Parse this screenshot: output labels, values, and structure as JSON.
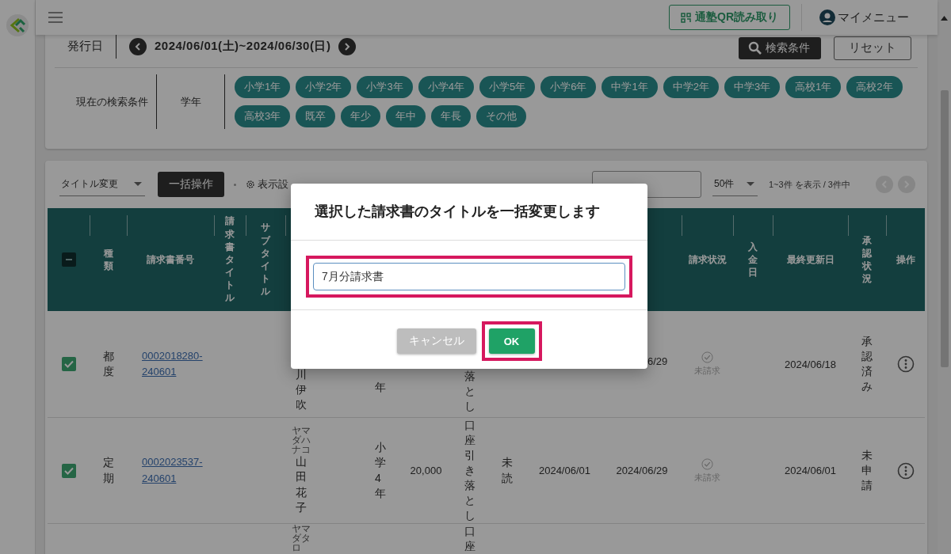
{
  "top_bar": {
    "qr_button": "通塾QR読み取り",
    "my_menu": "マイメニュー"
  },
  "search_panel": {
    "date_label": "発行日",
    "date_range": "2024/06/01(土)~2024/06/30(日)",
    "search_button": "検索条件",
    "reset_button": "リセット",
    "conditions_label": "現在の検索条件",
    "condition_name": "学年",
    "chips": [
      "小学1年",
      "小学2年",
      "小学3年",
      "小学4年",
      "小学5年",
      "小学6年",
      "中学1年",
      "中学2年",
      "中学3年",
      "高校1年",
      "高校2年",
      "高校3年",
      "既卒",
      "年少",
      "年中",
      "年長",
      "その他"
    ]
  },
  "list_toolbar": {
    "action_select": "タイトル変更",
    "bulk_button": "一括操作",
    "display_settings": "表示設",
    "page_size": "50件",
    "range_text": "1~3件 を表示 / 3件中",
    "prev_page": {
      "disabled": true
    },
    "next_page": {
      "disabled": true
    }
  },
  "table": {
    "select_all": {
      "indeterminate": true
    },
    "columns": [
      "種類",
      "請求書番号",
      "請求書タイトル",
      "サブタイトル",
      "請求状況",
      "入金日",
      "最終更新日",
      "承認状況",
      "操作"
    ],
    "rows": [
      {
        "selected": true,
        "type": "都度",
        "invoice_no": "0002018280-240601",
        "name": "川伊吹",
        "grade": "年",
        "payment": "落とし",
        "due": "6/29",
        "status": "未請求",
        "updated": "2024/06/18",
        "approval": "承認済み"
      },
      {
        "selected": true,
        "type": "定期",
        "invoice_no": "0002023537-240601",
        "kana": "ヤマダハナコ",
        "name": "山田花子",
        "grade": "小学4年",
        "amount": "20,000",
        "payment": "口座引き落とし",
        "read": "未読",
        "issued": "2024/06/01",
        "due": "2024/06/29",
        "status": "未請求",
        "updated": "2024/06/01",
        "approval": "未申請"
      },
      {
        "kana": "ヤマダタロ",
        "payment": "口座"
      }
    ]
  },
  "dialog": {
    "title": "選択した請求書のタイトルを一括変更します",
    "input": {
      "value": "7月分請求書",
      "highlighted": true
    },
    "cancel_button": "キャンセル",
    "ok_button": {
      "label": "OK",
      "highlighted": true
    }
  }
}
